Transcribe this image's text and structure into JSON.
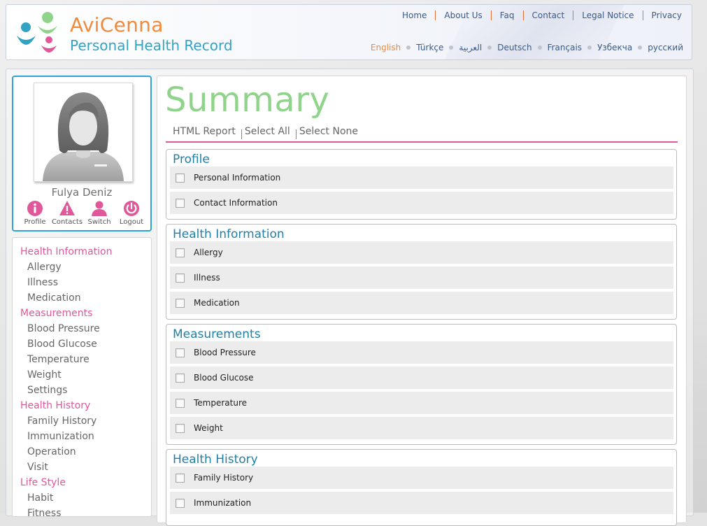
{
  "brand": {
    "name": "AviCenna",
    "subtitle": "Personal Health Record"
  },
  "topnav": [
    "Home",
    "About Us",
    "Faq",
    "Contact",
    "Legal Notice",
    "Privacy"
  ],
  "languages": {
    "items": [
      "English",
      "Türkçe",
      "العربية",
      "Deutsch",
      "Français",
      "Узбекча",
      "русский"
    ],
    "active": "English"
  },
  "user": {
    "name": "Fulya Deniz",
    "buttons": [
      {
        "label": "Profile",
        "icon": "info-icon"
      },
      {
        "label": "Contacts",
        "icon": "warning-icon"
      },
      {
        "label": "Switch",
        "icon": "person-icon"
      },
      {
        "label": "Logout",
        "icon": "power-icon"
      }
    ]
  },
  "sidebar": {
    "groups": [
      {
        "title": "Health Information",
        "items": [
          "Allergy",
          "Illness",
          "Medication"
        ]
      },
      {
        "title": "Measurements",
        "items": [
          "Blood Pressure",
          "Blood Glucose",
          "Temperature",
          "Weight",
          "Settings"
        ]
      },
      {
        "title": "Health History",
        "items": [
          "Family History",
          "Immunization",
          "Operation",
          "Visit"
        ]
      },
      {
        "title": "Life Style",
        "items": [
          "Habit",
          "Fitness"
        ]
      }
    ]
  },
  "main": {
    "title": "Summary",
    "actions": [
      "HTML Report",
      "Select All",
      "Select None"
    ],
    "sections": [
      {
        "title": "Profile",
        "items": [
          "Personal Information",
          "Contact Information"
        ]
      },
      {
        "title": "Health Information",
        "items": [
          "Allergy",
          "Illness",
          "Medication"
        ]
      },
      {
        "title": "Measurements",
        "items": [
          "Blood Pressure",
          "Blood Glucose",
          "Temperature",
          "Weight"
        ]
      },
      {
        "title": "Health History",
        "items": [
          "Family History",
          "Immunization"
        ]
      }
    ]
  },
  "colors": {
    "brand_orange": "#f08a3c",
    "brand_blue": "#33a3c4",
    "category_pink": "#e0589a",
    "title_green": "#8fd48a",
    "section_blue": "#1f7fa8"
  }
}
